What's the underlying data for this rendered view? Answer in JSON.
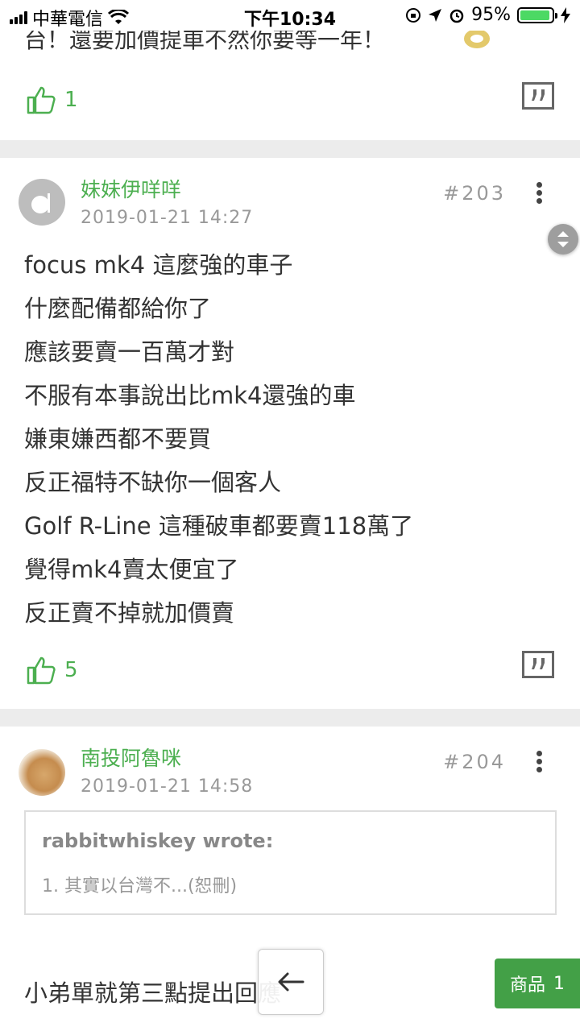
{
  "status_bar": {
    "carrier": "中華電信",
    "time": "下午10:34",
    "battery": "95%",
    "battery_level": 0.95
  },
  "previous_post": {
    "text_fragment": "台！還要加價提車不然你要等一年！",
    "likes": "1"
  },
  "posts": [
    {
      "username": "妹妹伊咩咩",
      "date": "2019-01-21 14:27",
      "floor": "#203",
      "lines": [
        "focus mk4 這麼強的車子",
        "什麼配備都給你了",
        "應該要賣一百萬才對",
        "不服有本事說出比mk4還強的車",
        "嫌東嫌西都不要買",
        "反正福特不缺你一個客人",
        "Golf R-Line 這種破車都要賣118萬了",
        "覺得mk4賣太便宜了",
        "反正賣不掉就加價賣"
      ],
      "likes": "5"
    },
    {
      "username": "南投阿魯咪",
      "date": "2019-01-21 14:58",
      "floor": "#204",
      "quote": {
        "author": "rabbitwhiskey wrote:",
        "text": "1. 其實以台灣不...(恕刪)"
      },
      "body_line": "小弟單就第三點提出回應"
    }
  ],
  "product_button": {
    "label": "商品",
    "count": "1"
  }
}
